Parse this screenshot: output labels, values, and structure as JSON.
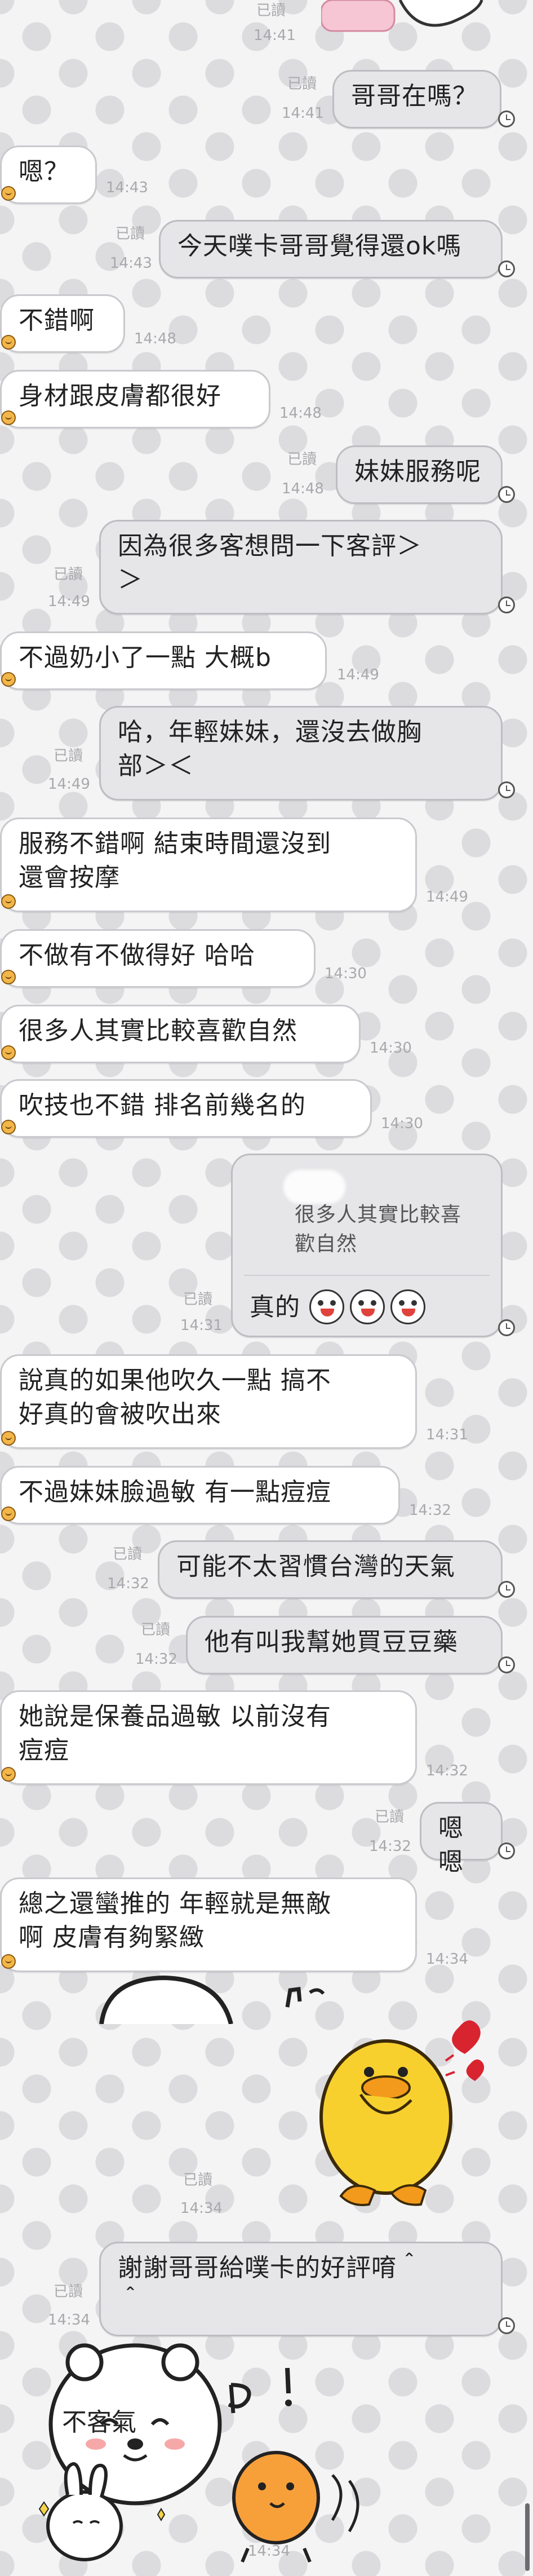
{
  "messages": [
    {
      "dir": "out",
      "text": "哥哥在嗎？",
      "status": "已讀",
      "time": "14:41"
    },
    {
      "dir": "in",
      "text": "嗯？",
      "time": "14:43"
    },
    {
      "dir": "out",
      "text": "今天噗卡哥哥覺得還ok嗎",
      "status": "已讀",
      "time": "14:43"
    },
    {
      "dir": "in",
      "text": "不錯啊",
      "time": "14:48"
    },
    {
      "dir": "in",
      "text": "身材跟皮膚都很好",
      "time": "14:48"
    },
    {
      "dir": "out",
      "text": "妹妹服務呢",
      "status": "已讀",
      "time": "14:48"
    },
    {
      "dir": "out",
      "text": "因為很多客想問一下客評＞＞",
      "status": "已讀",
      "time": "14:49"
    },
    {
      "dir": "in",
      "text": "不過奶小了一點 大概b",
      "time": "14:49"
    },
    {
      "dir": "out",
      "text": "哈，年輕妹妹，還沒去做胸部＞＜",
      "status": "已讀",
      "time": "14:49"
    },
    {
      "dir": "in",
      "text": "服務不錯啊 結束時間還沒到還會按摩",
      "time": "14:49"
    },
    {
      "dir": "in",
      "text": "不做有不做得好 哈哈",
      "time": "14:30"
    },
    {
      "dir": "in",
      "text": "很多人其實比較喜歡自然",
      "time": "14:30"
    },
    {
      "dir": "in",
      "text": "吹技也不錯 排名前幾名的",
      "time": "14:30"
    },
    {
      "dir": "out",
      "quote": "很多人其實比較喜歡自然",
      "text": "真的",
      "status": "已讀",
      "time": "14:31"
    },
    {
      "dir": "in",
      "text": "說真的如果他吹久一點 搞不好真的會被吹出來",
      "time": "14:31"
    },
    {
      "dir": "in",
      "text": "不過妹妹臉過敏 有一點痘痘",
      "time": "14:32"
    },
    {
      "dir": "out",
      "text": "可能不太習慣台灣的天氣",
      "status": "已讀",
      "time": "14:32"
    },
    {
      "dir": "out",
      "text": "他有叫我幫她買豆豆藥",
      "status": "已讀",
      "time": "14:32"
    },
    {
      "dir": "in",
      "text": "她說是保養品過敏 以前沒有痘痘",
      "time": "14:32"
    },
    {
      "dir": "out",
      "text": "嗯嗯",
      "status": "已讀",
      "time": "14:32"
    },
    {
      "dir": "in",
      "text": "總之還蠻推的 年輕就是無敵啊 皮膚有夠緊緻",
      "time": "14:34"
    },
    {
      "dir": "out",
      "sticker": "Sally duck sticker with hearts",
      "status": "已讀",
      "time": "14:34"
    },
    {
      "dir": "out",
      "text": "謝謝哥哥給噗卡的好評唷＾＾",
      "status": "已讀",
      "time": "14:34"
    },
    {
      "dir": "in",
      "sticker": "bear and rabbit sticker",
      "sticker_text": "不客氣",
      "time": "14:34"
    }
  ],
  "texts": {
    "m1": "哥哥在嗎？",
    "m2": "嗯？",
    "m3": "今天噗卡哥哥覺得還ok嗎",
    "m4": "不錯啊",
    "m5": "身材跟皮膚都很好",
    "m6": "妹妹服務呢",
    "m7a": "因為很多客想問一下客評＞",
    "m7b": "＞",
    "m8": "不過奶小了一點 大概b",
    "m9a": "哈，年輕妹妹，還沒去做胸",
    "m9b": "部＞＜",
    "m10a": "服務不錯啊 結束時間還沒到",
    "m10b": "還會按摩",
    "m11": "不做有不做得好 哈哈",
    "m12": "很多人其實比較喜歡自然",
    "m13": "吹技也不錯 排名前幾名的",
    "m14q1": "很多人其實比較喜",
    "m14q2": "歡自然",
    "m14": "真的",
    "m15a": "說真的如果他吹久一點 搞不",
    "m15b": "好真的會被吹出來",
    "m16": "不過妹妹臉過敏 有一點痘痘",
    "m17": "可能不太習慣台灣的天氣",
    "m18": "他有叫我幫她買豆豆藥",
    "m19a": "她說是保養品過敏 以前沒有",
    "m19b": "痘痘",
    "m20": "嗯嗯",
    "m21a": "總之還蠻推的 年輕就是無敵",
    "m21b": "啊 皮膚有夠緊緻",
    "m23a": "謝謝哥哥給噗卡的好評唷＾",
    "m23b": "＾",
    "sticker2_text": "不客氣"
  },
  "read_label": "已讀",
  "colors": {
    "in_bubble": "#ffffff",
    "out_bubble": "#e6e6e9",
    "background": "#f4f4f5",
    "dots": "#dcdcdf"
  }
}
